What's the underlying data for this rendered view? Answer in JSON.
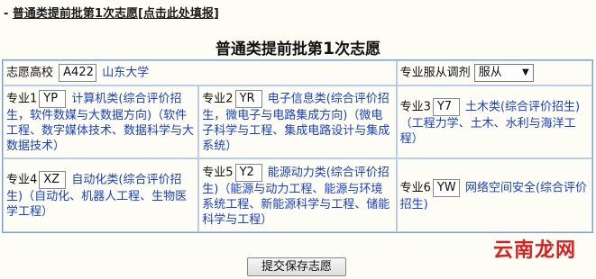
{
  "header": {
    "prefix": "- ",
    "link_text": "普通类提前批第1次志愿[点击此处填报]"
  },
  "form": {
    "title_pre": "普通类提前批第",
    "title_num": "1",
    "title_post": "次志愿",
    "school_label": "志愿高校",
    "school_code": "A422",
    "school_name": "山东大学",
    "adjust_label": "专业服从调剂",
    "adjust_value": "服从",
    "majors": [
      {
        "label": "专业1",
        "code": "YP",
        "name": "计算机类(综合评价招生，软件数媒与大数据方向)",
        "detail": "（软件工程、数字媒体技术、数据科学与大数据技术）"
      },
      {
        "label": "专业2",
        "code": "YR",
        "name": "电子信息类(综合评价招生，微电子与电路集成方向)",
        "detail": "（微电子科学与工程、集成电路设计与集成系统）"
      },
      {
        "label": "专业3",
        "code": "Y7",
        "name": "土木类(综合评价招生)",
        "detail": "（工程力学、土木、水利与海洋工程）"
      },
      {
        "label": "专业4",
        "code": "XZ",
        "name": "自动化类(综合评价招生)",
        "detail": "（自动化、机器人工程、生物医学工程）"
      },
      {
        "label": "专业5",
        "code": "Y2",
        "name": "能源动力类(综合评价招生)",
        "detail": "（能源与动力工程、能源与环境系统工程、新能源科学与工程、储能科学与工程）"
      },
      {
        "label": "专业6",
        "code": "YW",
        "name": "网络空间安全(综合评价招生)",
        "detail": ""
      }
    ],
    "submit_label": "提交保存志愿"
  },
  "watermark": "云南龙网"
}
